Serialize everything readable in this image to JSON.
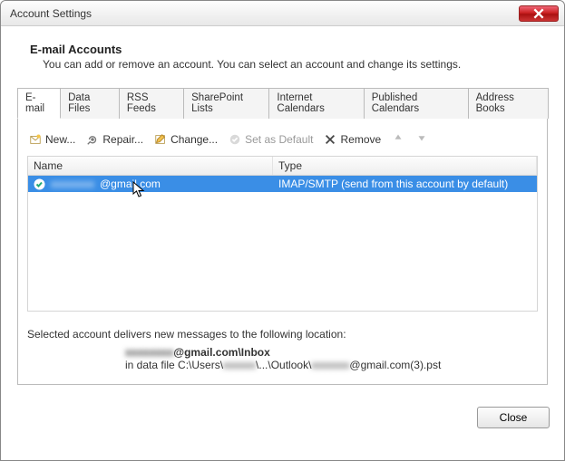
{
  "window": {
    "title": "Account Settings"
  },
  "header": {
    "heading": "E-mail Accounts",
    "subtext": "You can add or remove an account. You can select an account and change its settings."
  },
  "tabs": [
    "E-mail",
    "Data Files",
    "RSS Feeds",
    "SharePoint Lists",
    "Internet Calendars",
    "Published Calendars",
    "Address Books"
  ],
  "toolbar": {
    "new": "New...",
    "repair": "Repair...",
    "change": "Change...",
    "set_default": "Set as Default",
    "remove": "Remove"
  },
  "table": {
    "columns": {
      "name": "Name",
      "type": "Type"
    },
    "rows": [
      {
        "name_hidden": "xxxxxxxx",
        "name_visible": "@gmail.com",
        "type": "IMAP/SMTP (send from this account by default)"
      }
    ]
  },
  "location": {
    "intro": "Selected account delivers new messages to the following location:",
    "mailbox_hidden": "xxxxxxxx",
    "mailbox_suffix": "@gmail.com\\Inbox",
    "path_pre": "in data file C:\\Users\\",
    "path_mid1_hidden": "xxxxxx",
    "path_mid": "\\...\\Outlook\\",
    "path_mid2_hidden": "xxxxxxx",
    "path_post": "@gmail.com(3).pst"
  },
  "footer": {
    "close": "Close"
  }
}
